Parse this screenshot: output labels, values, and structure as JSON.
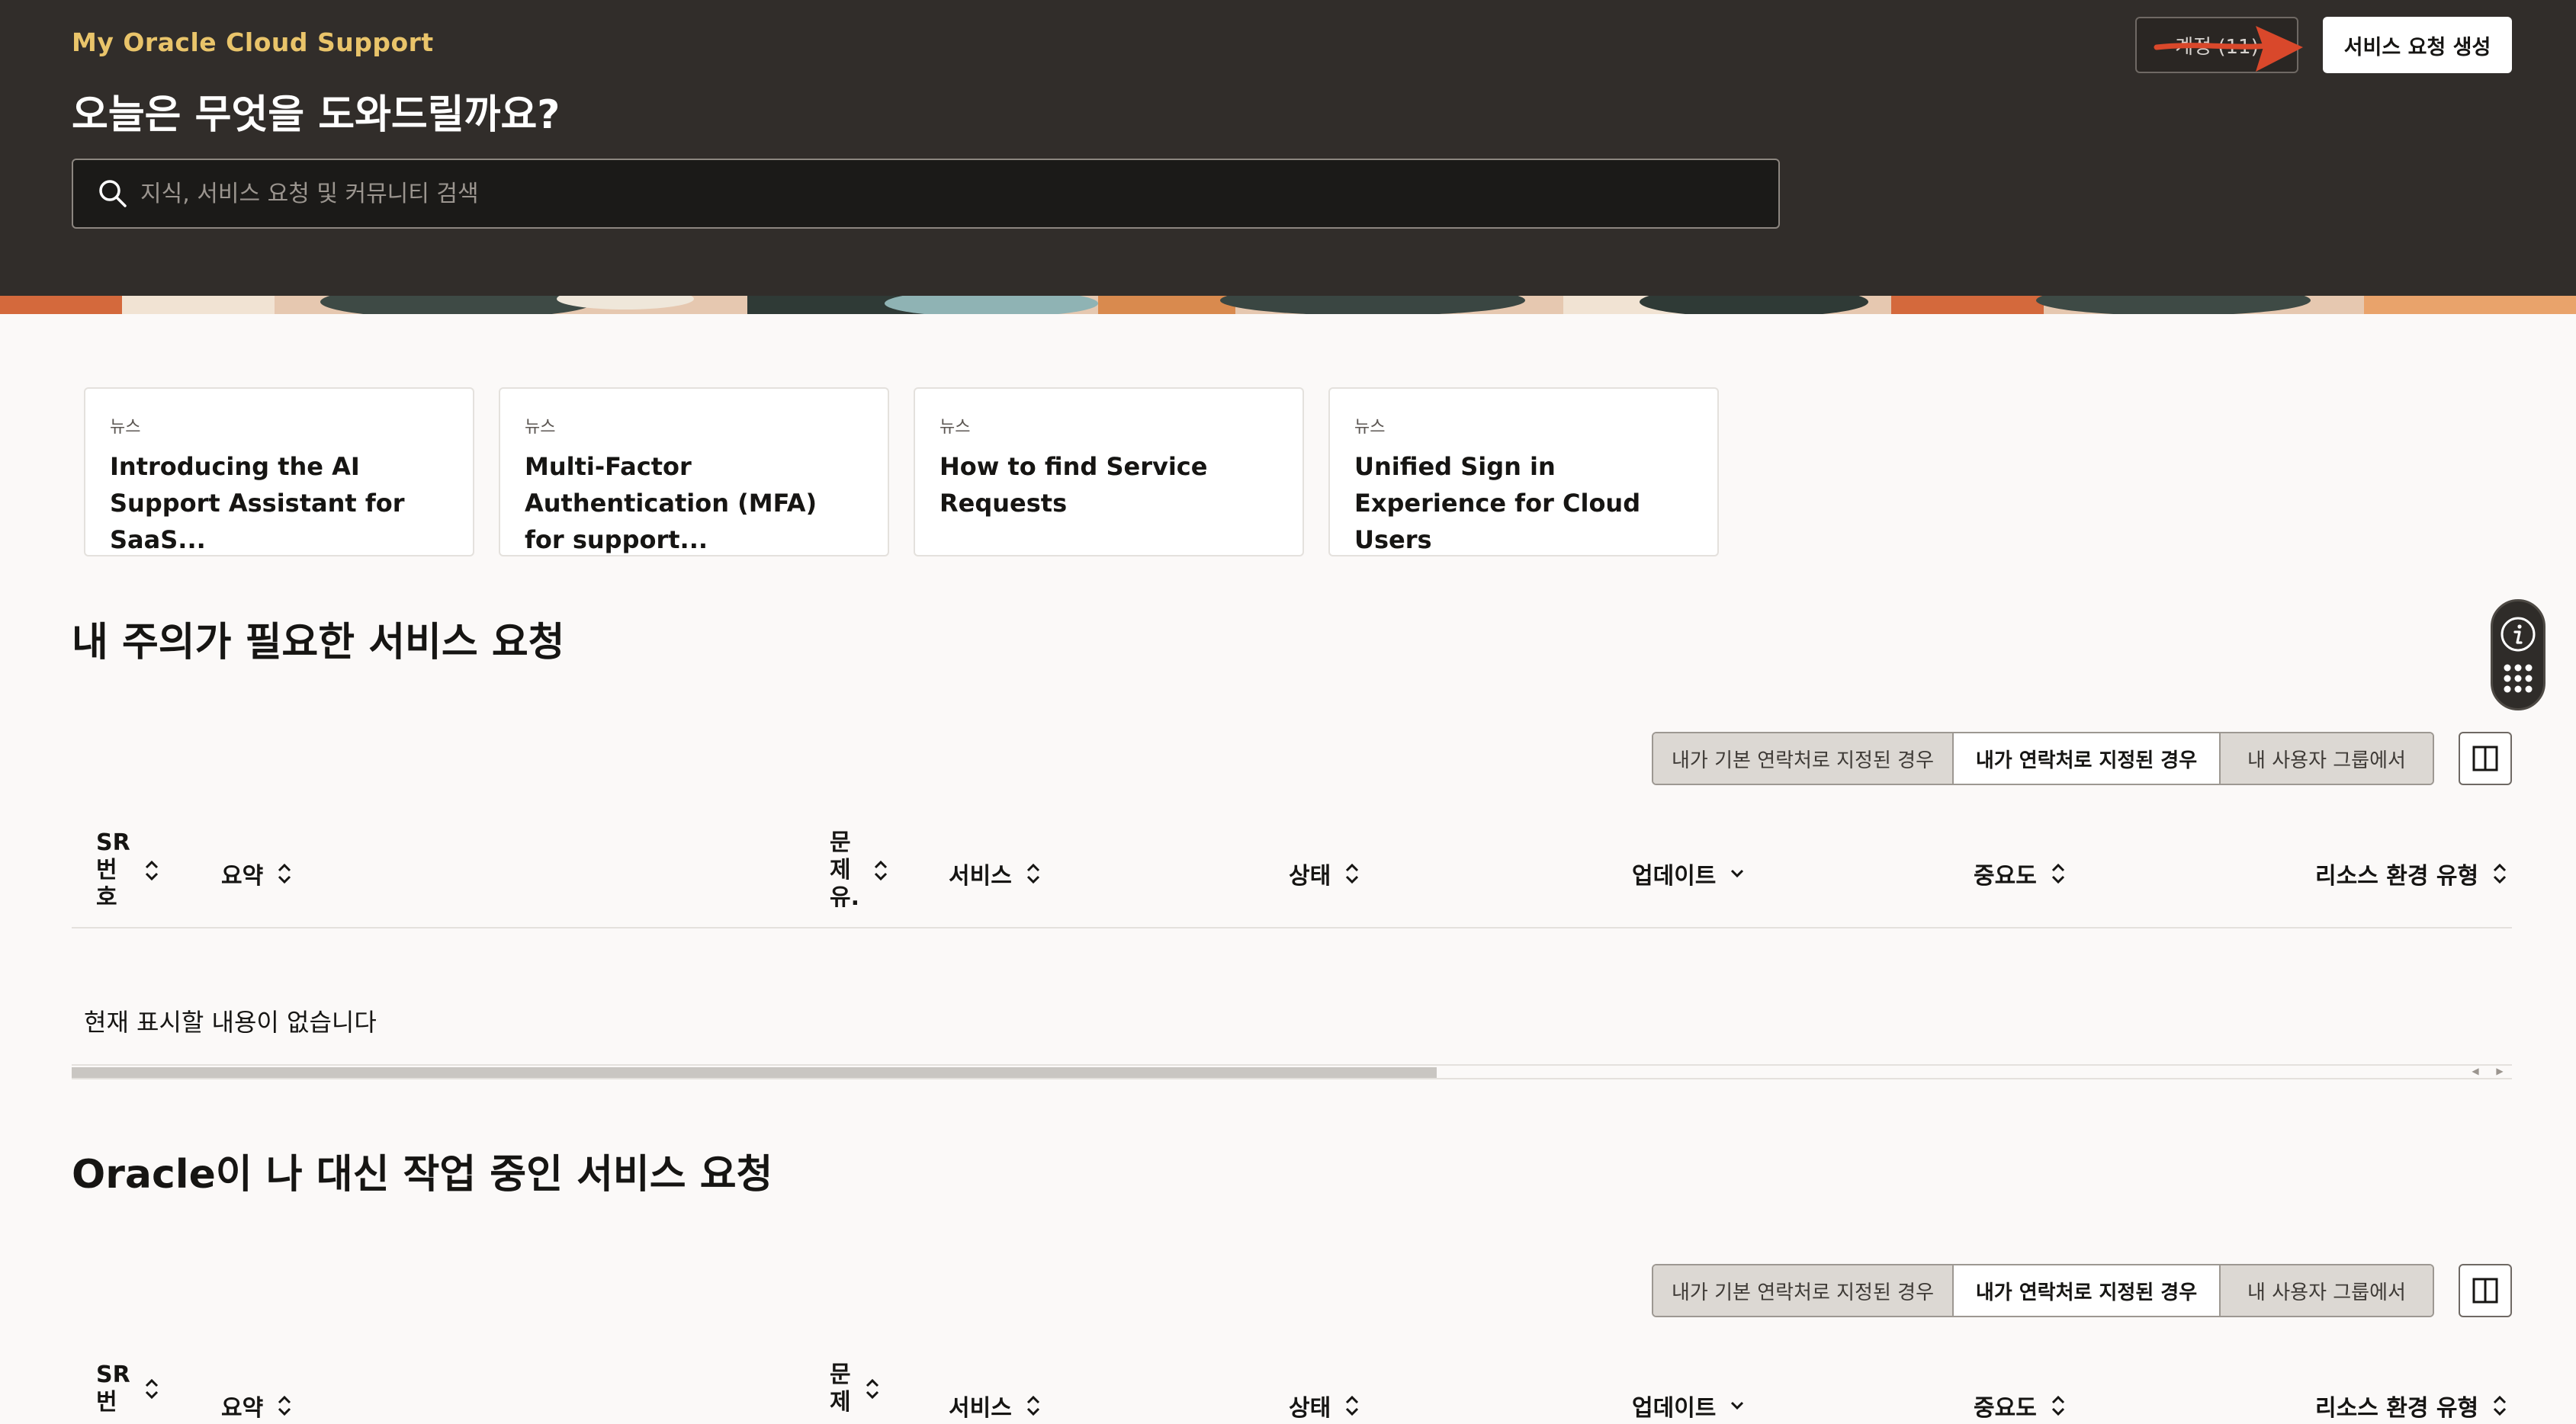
{
  "header": {
    "brand": "My Oracle Cloud Support",
    "greeting": "오늘은 무엇을 도와드릴까요?",
    "search_placeholder": "지식, 서비스 요청 및 커뮤니티 검색",
    "account_label": "계정 (11)",
    "create_label": "서비스 요청 생성"
  },
  "news": [
    {
      "tag": "뉴스",
      "title": "Introducing the AI Support Assistant for SaaS..."
    },
    {
      "tag": "뉴스",
      "title": "Multi-Factor Authentication (MFA) for support..."
    },
    {
      "tag": "뉴스",
      "title": "How to find Service Requests"
    },
    {
      "tag": "뉴스",
      "title": "Unified Sign in Experience for Cloud Users"
    }
  ],
  "sections": [
    {
      "title": "내 주의가 필요한 서비스 요청",
      "filters": [
        "내가 기본 연락처로 지정된 경우",
        "내가 연락처로 지정된 경우",
        "내 사용자 그룹에서"
      ],
      "empty_message": "현재 표시할 내용이 없습니다"
    },
    {
      "title": "Oracle이 나 대신 작업 중인 서비스 요청",
      "filters": [
        "내가 기본 연락처로 지정된 경우",
        "내가 연락처로 지정된 경우",
        "내 사용자 그룹에서"
      ]
    }
  ],
  "columns": {
    "sr_l1": "SR",
    "sr_l2": "번",
    "sr_l3": "호",
    "summary": "요약",
    "prob_l1": "문",
    "prob_l2": "제",
    "prob_l3": "유.",
    "service": "서비스",
    "status": "상태",
    "update": "업데이트",
    "severity": "중요도",
    "env": "리소스 환경 유형"
  },
  "icons": {
    "search": "search-icon",
    "sort": "sort-icon",
    "columns": "column-layout-icon",
    "info": "info-icon",
    "apps": "apps-grid-icon"
  },
  "colors": {
    "header_bg": "#312d2a",
    "brand": "#e9c46a",
    "page_bg": "#fbf9f8",
    "annotation": "#d9482b"
  }
}
